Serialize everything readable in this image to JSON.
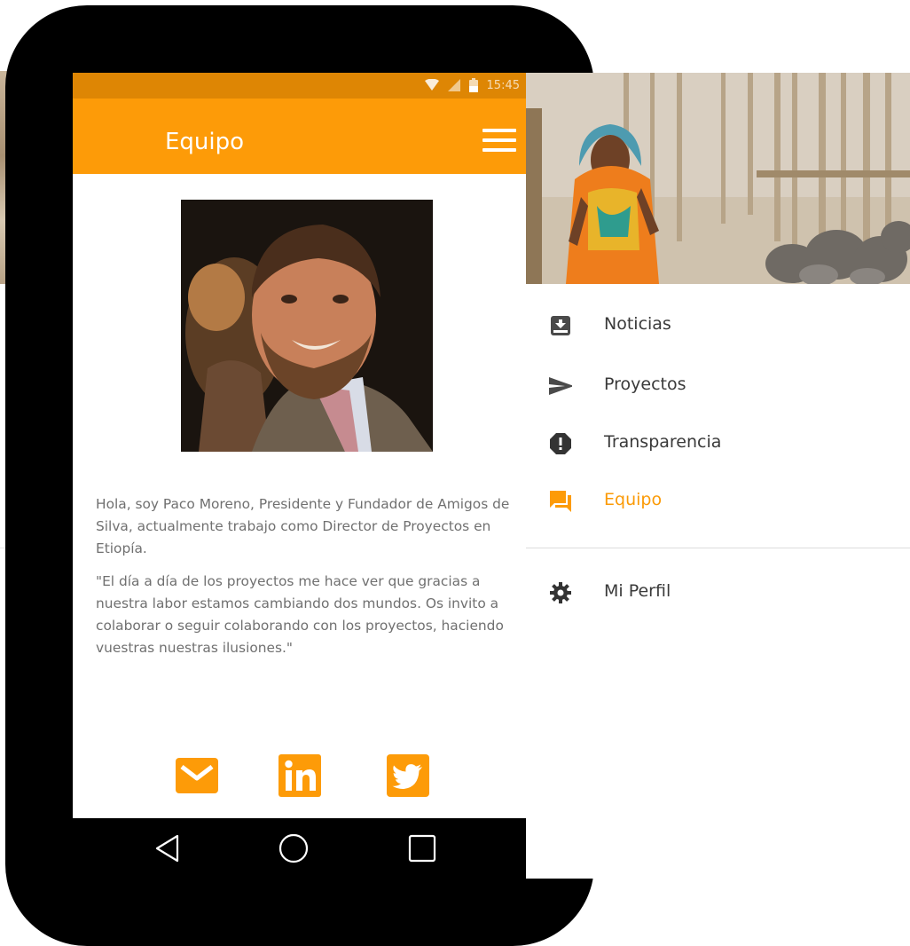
{
  "status_bar": {
    "time": "15:45"
  },
  "app_bar": {
    "title": "Equipo"
  },
  "profile": {
    "bio": "Hola, soy Paco Moreno, Presidente y Fundador de Amigos de Silva, actualmente trabajo como Director de Proyectos en Etiopía.",
    "quote": "\"El día a día de los proyectos me hace ver que gracias a nuestra labor estamos cambiando dos mundos. Os invito a colaborar o seguir colaborando con los proyectos, haciendo vuestras nuestras ilusiones.\""
  },
  "social": [
    "email-icon",
    "linkedin-icon",
    "twitter-icon"
  ],
  "drawer": {
    "items": [
      {
        "label": "Noticias",
        "icon": "inbox-icon"
      },
      {
        "label": "Proyectos",
        "icon": "send-icon"
      },
      {
        "label": "Transparencia",
        "icon": "alert-icon"
      },
      {
        "label": "Equipo",
        "icon": "forum-icon",
        "active": true
      }
    ],
    "secondary": [
      {
        "label": "Mi Perfil",
        "icon": "settings-icon"
      }
    ]
  },
  "colors": {
    "accent": "#fd9b08",
    "status_bar": "#de8604",
    "text_muted": "#707070",
    "drawer_text": "#3a3a3a"
  }
}
